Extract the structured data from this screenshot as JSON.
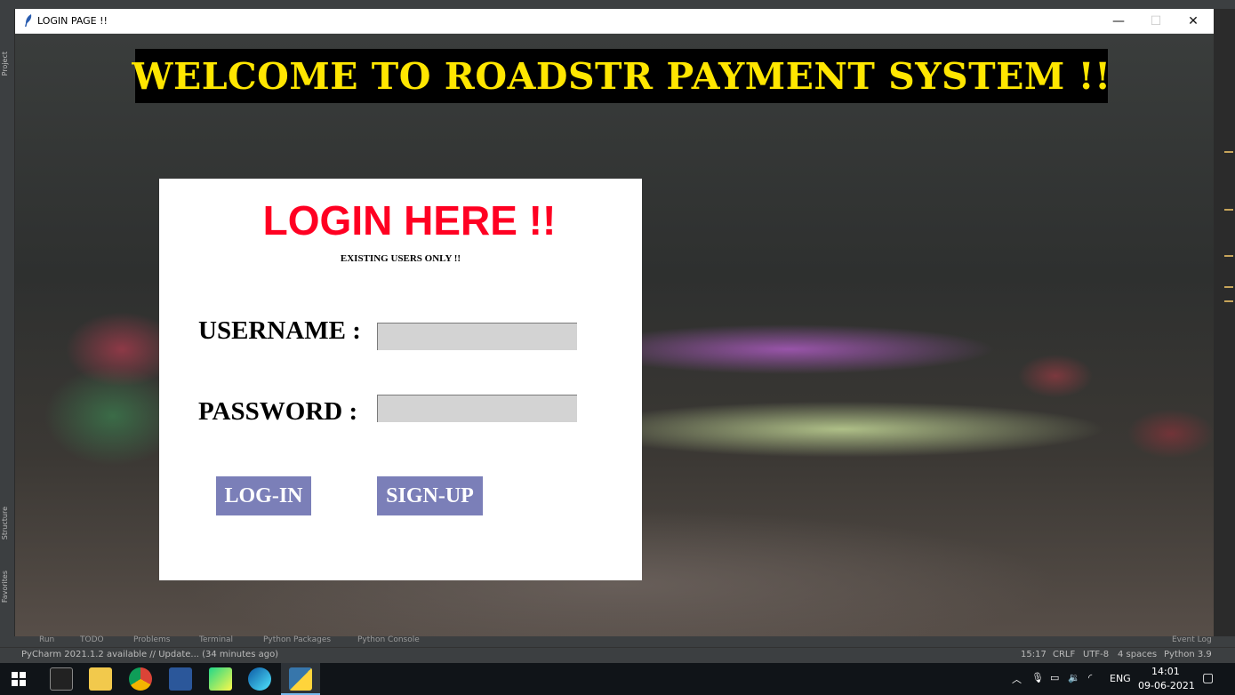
{
  "window": {
    "title": "LOGIN PAGE !!",
    "minimize_glyph": "—",
    "maximize_glyph": "☐",
    "close_glyph": "✕"
  },
  "banner": {
    "text": "WELCOME TO ROADSTR PAYMENT SYSTEM !!"
  },
  "login_panel": {
    "title": "LOGIN HERE !!",
    "subtitle": "EXISTING USERS ONLY !!",
    "username_label": "USERNAME :",
    "username_value": "",
    "password_label": "PASSWORD :",
    "password_value": "",
    "login_button": "LOG-IN",
    "signup_button": "SIGN-UP"
  },
  "ide": {
    "left_tabs": [
      "Project",
      "Structure",
      "Favorites"
    ],
    "tool_tabs": [
      "Run",
      "TODO",
      "Problems",
      "Terminal",
      "Python Packages",
      "Python Console"
    ],
    "event_log": "Event Log",
    "status_message": "PyCharm 2021.1.2 available // Update... (34 minutes ago)",
    "cursor_position": "15:17",
    "line_separator": "CRLF",
    "encoding": "UTF-8",
    "indent": "4 spaces",
    "interpreter": "Python 3.9"
  },
  "taskbar": {
    "icons": [
      "windows-start-icon",
      "terminal-icon",
      "file-explorer-icon",
      "chrome-icon",
      "word-icon",
      "pycharm-icon",
      "edge-icon",
      "python-icon"
    ],
    "language": "ENG",
    "time": "14:01",
    "date": "09-06-2021"
  },
  "colors": {
    "banner_bg": "#000000",
    "banner_text": "#ffe600",
    "login_title": "#ff0022",
    "field_bg": "#d3d3d3",
    "button_bg": "#7b7fb8"
  }
}
